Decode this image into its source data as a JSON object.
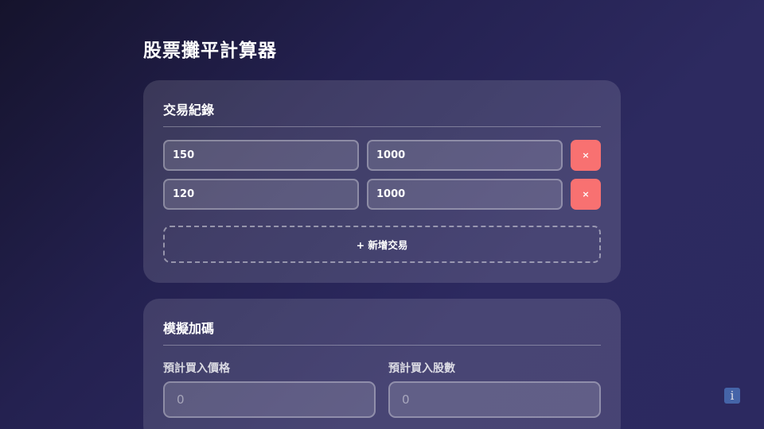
{
  "header": {
    "title": "股票攤平計算器"
  },
  "records": {
    "title": "交易紀錄",
    "rows": [
      {
        "price": "150",
        "shares": "1000",
        "delete_label": "×"
      },
      {
        "price": "120",
        "shares": "1000",
        "delete_label": "×"
      }
    ],
    "add_label": "+ 新增交易"
  },
  "simulate": {
    "title": "模擬加碼",
    "buy_price_label": "預計買入價格",
    "buy_price_placeholder": "0",
    "buy_shares_label": "預計買入股數",
    "buy_shares_placeholder": "0"
  },
  "info_button": {
    "icon": "info-icon",
    "glyph": "i"
  },
  "colors": {
    "delete_button": "#f87171",
    "info_button": "#4a6fb5",
    "background_start": "#15132c",
    "background_end": "#2c2960"
  }
}
